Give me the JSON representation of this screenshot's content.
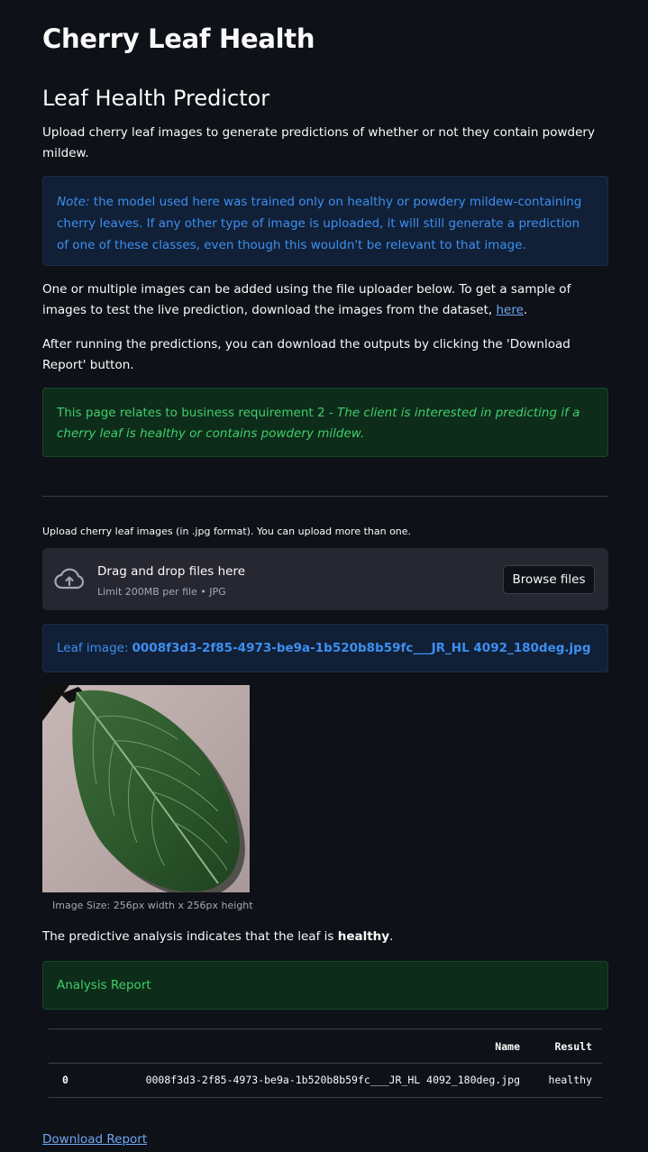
{
  "app_title": "Cherry Leaf Health",
  "page_title": "Leaf Health Predictor",
  "intro": "Upload cherry leaf images to generate predictions of whether or not they contain powdery mildew.",
  "note": {
    "label": "Note:",
    "text": " the model used here was trained only on healthy or powdery mildew-containing cherry leaves. If any other type of image is uploaded, it will still generate a prediction of one of these classes, even though this wouldn't be relevant to that image."
  },
  "uploader_instructions": {
    "text": "One or multiple images can be added using the file uploader below. To get a sample of images to test the live prediction, download the images from the dataset, ",
    "link": "here",
    "suffix": "."
  },
  "download_instructions": "After running the predictions, you can download the outputs by clicking the 'Download Report' button.",
  "business_req": {
    "prefix": "This page relates to business requirement 2 - ",
    "emphasis": "The client is interested in predicting if a cherry leaf is healthy or contains powdery mildew."
  },
  "uploader": {
    "label": "Upload cherry leaf images (in .jpg format). You can upload more than one.",
    "drag_title": "Drag and drop files here",
    "limit": "Limit 200MB per file • JPG",
    "browse_label": "Browse files"
  },
  "file_info": {
    "label": "Leaf image:",
    "filename": "0008f3d3-2f85-4973-be9a-1b520b8b59fc___JR_HL 4092_180deg.jpg"
  },
  "image_caption": "Image Size: 256px width x 256px height",
  "prediction": {
    "prefix": "The predictive analysis indicates that the leaf is ",
    "result": "healthy",
    "suffix": "."
  },
  "report_title": "Analysis Report",
  "table": {
    "headers": [
      "",
      "Name",
      "Result"
    ],
    "rows": [
      [
        "0",
        "0008f3d3-2f85-4973-be9a-1b520b8b59fc___JR_HL 4092_180deg.jpg",
        "healthy"
      ]
    ]
  },
  "download_link": "Download Report",
  "colors": {
    "background": "#0e1117",
    "info_text": "#3d8ff0",
    "success_text": "#3fcf6a",
    "link": "#6ea7f5"
  },
  "icons": [
    "cloud-upload-icon"
  ]
}
